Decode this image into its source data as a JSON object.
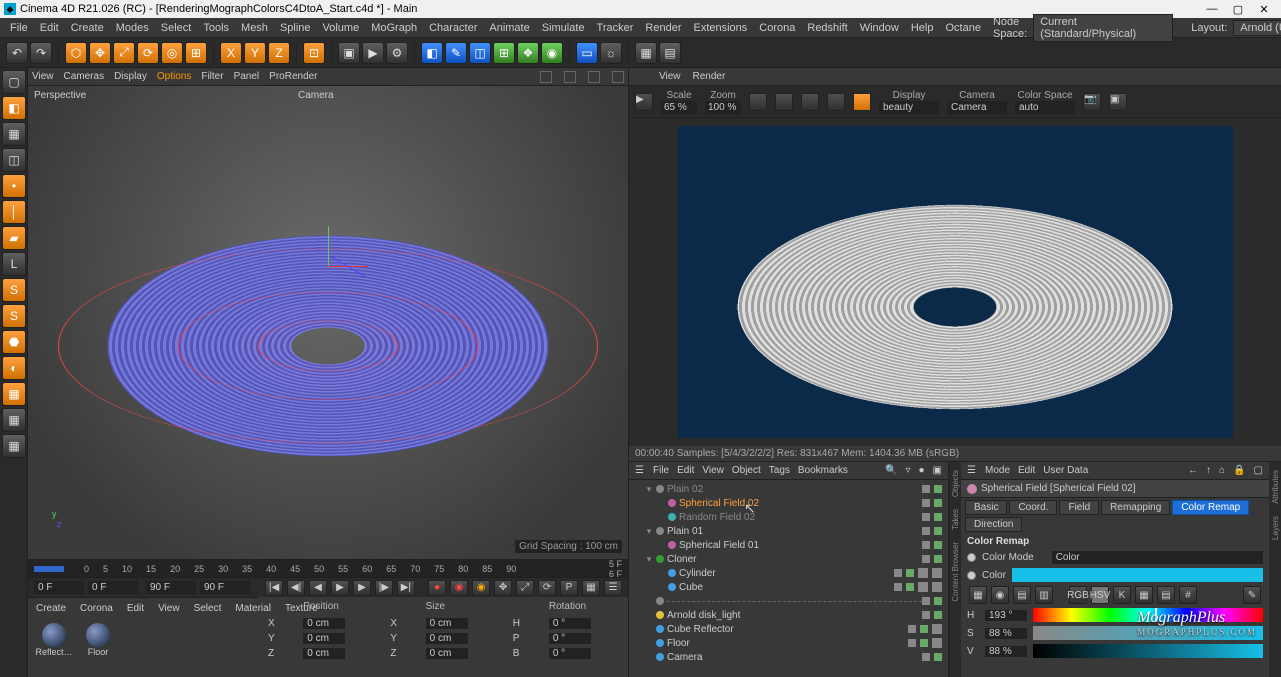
{
  "title": "Cinema 4D R21.026 (RC) - [RenderingMographColorsC4DtoA_Start.c4d *] - Main",
  "menu": [
    "File",
    "Edit",
    "Create",
    "Modes",
    "Select",
    "Tools",
    "Mesh",
    "Spline",
    "Volume",
    "MoGraph",
    "Character",
    "Animate",
    "Simulate",
    "Tracker",
    "Render",
    "Extensions",
    "Corona",
    "Redshift",
    "Window",
    "Help",
    "Octane"
  ],
  "nodespace_label": "Node Space:",
  "nodespace_value": "Current (Standard/Physical)",
  "layout_label": "Layout:",
  "layout_value": "Arnold (User)",
  "viewport": {
    "menu": [
      "View",
      "Cameras",
      "Display",
      "Options",
      "Filter",
      "Panel",
      "ProRender"
    ],
    "menu_highlight_idx": 3,
    "label": "Perspective",
    "camera": "Camera",
    "grid": "Grid Spacing : 100 cm"
  },
  "timeline": {
    "ticks": [
      "0",
      "5",
      "10",
      "15",
      "20",
      "25",
      "30",
      "35",
      "40",
      "45",
      "50",
      "55",
      "60",
      "65",
      "70",
      "75",
      "80",
      "85",
      "90"
    ],
    "suffix_top": "5 F",
    "suffix_bot": "6 F",
    "f_start1": "0 F",
    "f_start2": "0 F",
    "f_end1": "90 F",
    "f_end2": "90 F"
  },
  "mat_menu": [
    "Create",
    "Corona",
    "Edit",
    "View",
    "Select",
    "Material",
    "Texture"
  ],
  "swatches": [
    "Reflect…",
    "Floor"
  ],
  "coords": {
    "headers": [
      "Position",
      "Size",
      "Rotation"
    ],
    "rows": [
      {
        "k": "X",
        "p": "0 cm",
        "sk": "X",
        "s": "0 cm",
        "rk": "H",
        "r": "0 °"
      },
      {
        "k": "Y",
        "p": "0 cm",
        "sk": "Y",
        "s": "0 cm",
        "rk": "P",
        "r": "0 °"
      },
      {
        "k": "Z",
        "p": "0 cm",
        "sk": "Z",
        "s": "0 cm",
        "rk": "B",
        "r": "0 °"
      }
    ]
  },
  "render_bar": [
    "View",
    "Render"
  ],
  "render_tool": {
    "scale_lbl": "Scale",
    "zoom_lbl": "Zoom",
    "scale": "65 %",
    "zoom": "100 %",
    "display_lbl": "Display",
    "camera_lbl": "Camera",
    "cspace_lbl": "Color Space",
    "display_val": "beauty",
    "camera_val": "Camera",
    "cspace_val": "auto"
  },
  "render_status": "00:00:40   Samples: [5/4/3/2/2/2]   Res: 831x467   Mem: 1404.36 MB   (sRGB)",
  "om": {
    "menu": [
      "File",
      "Edit",
      "View",
      "Object",
      "Tags",
      "Bookmarks"
    ],
    "items": [
      {
        "name": "Plain 02",
        "indent": 1,
        "dim": true,
        "chev": "▾"
      },
      {
        "name": "Spherical Field 02",
        "indent": 2,
        "sel": true,
        "dot": "#c060a0",
        "cursor": true
      },
      {
        "name": "Random Field 02",
        "indent": 2,
        "dim": true,
        "dot": "#40b0b0"
      },
      {
        "name": "Plain 01",
        "indent": 1,
        "chev": "▾"
      },
      {
        "name": "Spherical Field 01",
        "indent": 2,
        "dot": "#c060a0"
      },
      {
        "name": "Cloner",
        "indent": 1,
        "dot": "#30a030",
        "chev": "▾"
      },
      {
        "name": "Cylinder",
        "indent": 2,
        "dot": "#40a0e0",
        "tags": 2
      },
      {
        "name": "Cube",
        "indent": 2,
        "dot": "#40a0e0",
        "tags": 2
      },
      {
        "name": "",
        "indent": 1,
        "dash": true
      },
      {
        "name": "Arnold disk_light",
        "indent": 1,
        "dot": "#e0c040"
      },
      {
        "name": "Cube Reflector",
        "indent": 1,
        "dot": "#40a0e0",
        "tags": 1
      },
      {
        "name": "Floor",
        "indent": 1,
        "dot": "#40a0e0",
        "tags": 1
      },
      {
        "name": "Camera",
        "indent": 1,
        "dot": "#40a0e0"
      }
    ]
  },
  "attr": {
    "menu": [
      "Mode",
      "Edit",
      "User Data"
    ],
    "title": "Spherical Field [Spherical Field 02]",
    "tabs": [
      "Basic",
      "Coord.",
      "Field",
      "Remapping",
      "Color Remap"
    ],
    "active_tab": 4,
    "tabs2": [
      "Direction"
    ],
    "section": "Color Remap",
    "mode_lbl": "Color Mode",
    "mode_val": "Color",
    "color_lbl": "Color",
    "hsv": {
      "H_lbl": "H",
      "H": "193 °",
      "S_lbl": "S",
      "S": "88 %",
      "V_lbl": "V",
      "V": "88 %"
    }
  },
  "watermark": "MographPlus",
  "watermark_sub": "MOGRAPHPLUS.COM"
}
